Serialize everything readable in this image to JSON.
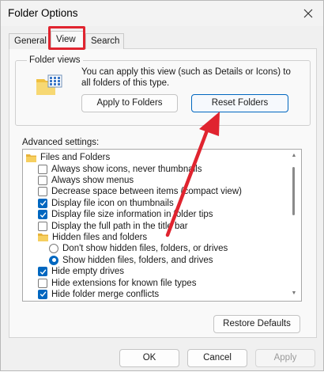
{
  "window": {
    "title": "Folder Options"
  },
  "tabs": [
    {
      "label": "General",
      "active": false
    },
    {
      "label": "View",
      "active": true
    },
    {
      "label": "Search",
      "active": false
    }
  ],
  "folder_views": {
    "legend": "Folder views",
    "description": "You can apply this view (such as Details or Icons) to all folders of this type.",
    "apply_button": "Apply to Folders",
    "reset_button": "Reset Folders"
  },
  "advanced": {
    "label": "Advanced settings:",
    "items": [
      {
        "type": "folder",
        "label": "Files and Folders",
        "indent": 0
      },
      {
        "type": "checkbox",
        "label": "Always show icons, never thumbnails",
        "checked": false,
        "indent": 1
      },
      {
        "type": "checkbox",
        "label": "Always show menus",
        "checked": false,
        "indent": 1
      },
      {
        "type": "checkbox",
        "label": "Decrease space between items (compact view)",
        "checked": false,
        "indent": 1
      },
      {
        "type": "checkbox",
        "label": "Display file icon on thumbnails",
        "checked": true,
        "indent": 1
      },
      {
        "type": "checkbox",
        "label": "Display file size information in folder tips",
        "checked": true,
        "indent": 1
      },
      {
        "type": "checkbox",
        "label": "Display the full path in the title bar",
        "checked": false,
        "indent": 1
      },
      {
        "type": "folder",
        "label": "Hidden files and folders",
        "indent": 1
      },
      {
        "type": "radio",
        "label": "Don't show hidden files, folders, or drives",
        "checked": false,
        "indent": 2
      },
      {
        "type": "radio",
        "label": "Show hidden files, folders, and drives",
        "checked": true,
        "indent": 2
      },
      {
        "type": "checkbox",
        "label": "Hide empty drives",
        "checked": true,
        "indent": 1
      },
      {
        "type": "checkbox",
        "label": "Hide extensions for known file types",
        "checked": false,
        "indent": 1
      },
      {
        "type": "checkbox",
        "label": "Hide folder merge conflicts",
        "checked": true,
        "indent": 1
      }
    ],
    "restore_button": "Restore Defaults"
  },
  "footer": {
    "ok": "OK",
    "cancel": "Cancel",
    "apply": "Apply"
  },
  "colors": {
    "accent": "#0067c0",
    "annotation": "#e0242f"
  },
  "icons": {
    "close": "close-icon",
    "folder": "folder-icon",
    "folder_views": "folder-views-icon"
  }
}
